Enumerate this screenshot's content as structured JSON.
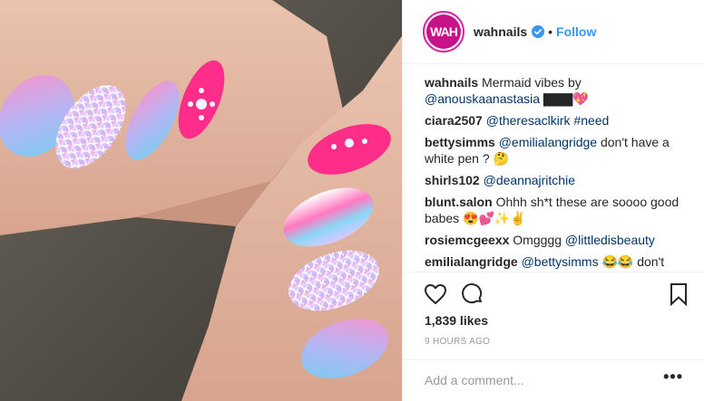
{
  "header": {
    "avatar_text": "WAH",
    "username": "wahnails",
    "separator": "•",
    "follow_label": "Follow"
  },
  "comments": [
    {
      "user": "wahnails",
      "text": "Mermaid vibes by ",
      "mention": "@anouskaanastasia",
      "tail": " ▇▇▇💖"
    },
    {
      "user": "ciara2507",
      "text": "",
      "mention": "@theresaclkirk #need",
      "tail": ""
    },
    {
      "user": "bettysimms",
      "text": "",
      "mention": "@emilialangridge",
      "tail": " don't have a white pen ? 🤔"
    },
    {
      "user": "shirls102",
      "text": "",
      "mention": "@deannajritchie",
      "tail": ""
    },
    {
      "user": "blunt.salon",
      "text": "Ohhh sh*t these are soooo good babes 😍💕✨✌️",
      "mention": "",
      "tail": ""
    },
    {
      "user": "rosiemcgeexx",
      "text": "Omgggg ",
      "mention": "@littledisbeauty",
      "tail": ""
    },
    {
      "user": "emilialangridge",
      "text": "",
      "mention": "@bettysimms",
      "tail": " 😂😂 don't"
    }
  ],
  "actions": {
    "like_icon": "heart-icon",
    "comment_icon": "comment-icon",
    "save_icon": "bookmark-icon"
  },
  "likes": "1,839 likes",
  "time_ago": "9 HOURS AGO",
  "add_comment": {
    "placeholder": "Add a comment...",
    "more": "•••"
  },
  "colors": {
    "accent": "#3897f0",
    "mention": "#003569",
    "avatar": "#c7128a"
  }
}
